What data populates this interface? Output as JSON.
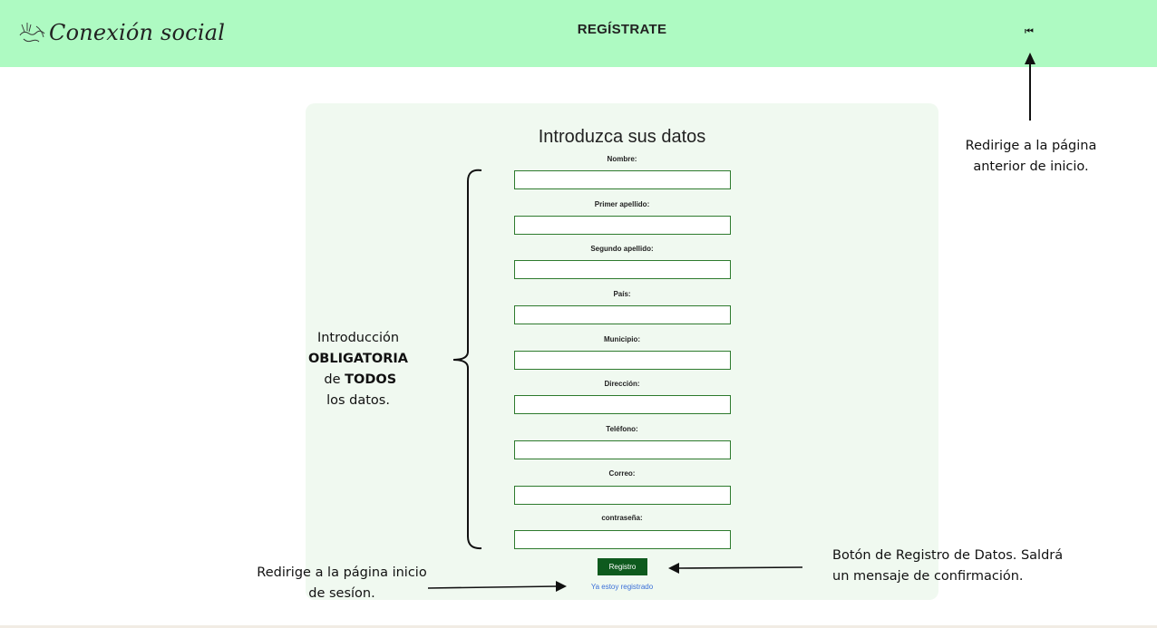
{
  "header": {
    "logo_text": "Conexión social",
    "title": "REGÍSTRATE",
    "back_icon": "rewind-icon",
    "back_glyph": "⏮"
  },
  "form": {
    "title": "Introduzca sus datos",
    "fields": [
      {
        "label": "Nombre:",
        "value": ""
      },
      {
        "label": "Primer apellido:",
        "value": ""
      },
      {
        "label": "Segundo apellido:",
        "value": ""
      },
      {
        "label": "País:",
        "value": ""
      },
      {
        "label": "Municipio:",
        "value": ""
      },
      {
        "label": "Dirección:",
        "value": ""
      },
      {
        "label": "Teléfono:",
        "value": ""
      },
      {
        "label": "Correo:",
        "value": ""
      },
      {
        "label": "contraseña:",
        "value": ""
      }
    ],
    "submit_label": "Registro",
    "login_link": "Ya estoy registrado"
  },
  "annotations": {
    "left": {
      "line1": "Introducción",
      "bold1": "OBLIGATORIA",
      "mid": " de ",
      "bold2": "TODOS",
      "line3": "los datos."
    },
    "top_right": {
      "line1": "Redirige a la página",
      "line2": "anterior de inicio."
    },
    "bottom_right": {
      "line1": "Botón de Registro de Datos. Saldrá",
      "line2": "un mensaje de confirmación."
    },
    "bottom_left": {
      "line1": "Redirige a la página inicio",
      "line2": "de sesíon."
    }
  },
  "colors": {
    "header_bg": "#aefac2",
    "card_bg": "#f0f9f0",
    "input_border": "#2d7a2d",
    "button_bg": "#0e5a1e",
    "link": "#3a6fd8"
  }
}
